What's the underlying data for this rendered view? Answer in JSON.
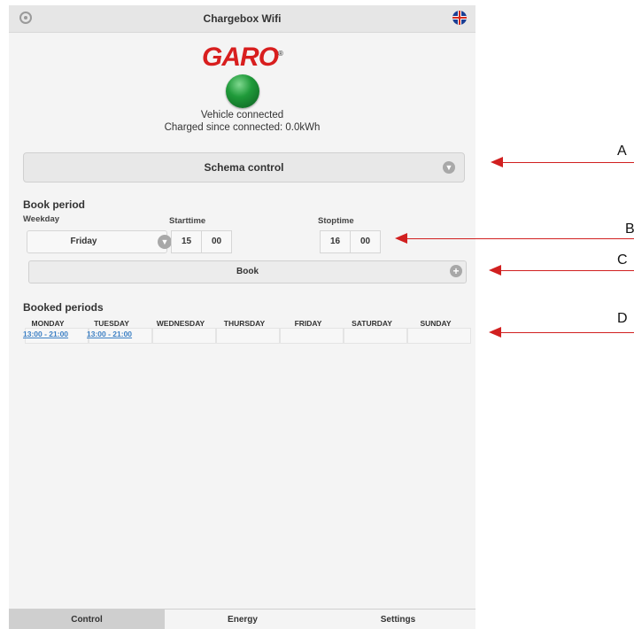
{
  "header": {
    "title": "Chargebox Wifi",
    "settings_icon": "gear-icon",
    "language_icon": "uk-flag-icon"
  },
  "logo": {
    "text": "GARO",
    "mark": "®"
  },
  "status": {
    "light_color": "#1f9a3a",
    "line1": "Vehicle connected",
    "line2": "Charged since connected: 0.0kWh"
  },
  "schema": {
    "label": "Schema control"
  },
  "book_period": {
    "title": "Book period",
    "weekday_label": "Weekday",
    "weekday_value": "Friday",
    "starttime_label": "Starttime",
    "start_hour": "15",
    "start_min": "00",
    "stoptime_label": "Stoptime",
    "stop_hour": "16",
    "stop_min": "00",
    "book_label": "Book"
  },
  "booked": {
    "title": "Booked periods",
    "days": [
      "MONDAY",
      "TUESDAY",
      "WEDNESDAY",
      "THURSDAY",
      "FRIDAY",
      "SATURDAY",
      "SUNDAY"
    ],
    "periods": [
      "13:00 - 21:00",
      "13:00 - 21:00"
    ]
  },
  "tabs": [
    "Control",
    "Energy",
    "Settings"
  ],
  "annotations": [
    "A",
    "B",
    "C",
    "D"
  ],
  "colors": {
    "accent_red": "#d81e1e",
    "link_blue": "#3b7fc4",
    "arrow_red": "#d12020"
  }
}
